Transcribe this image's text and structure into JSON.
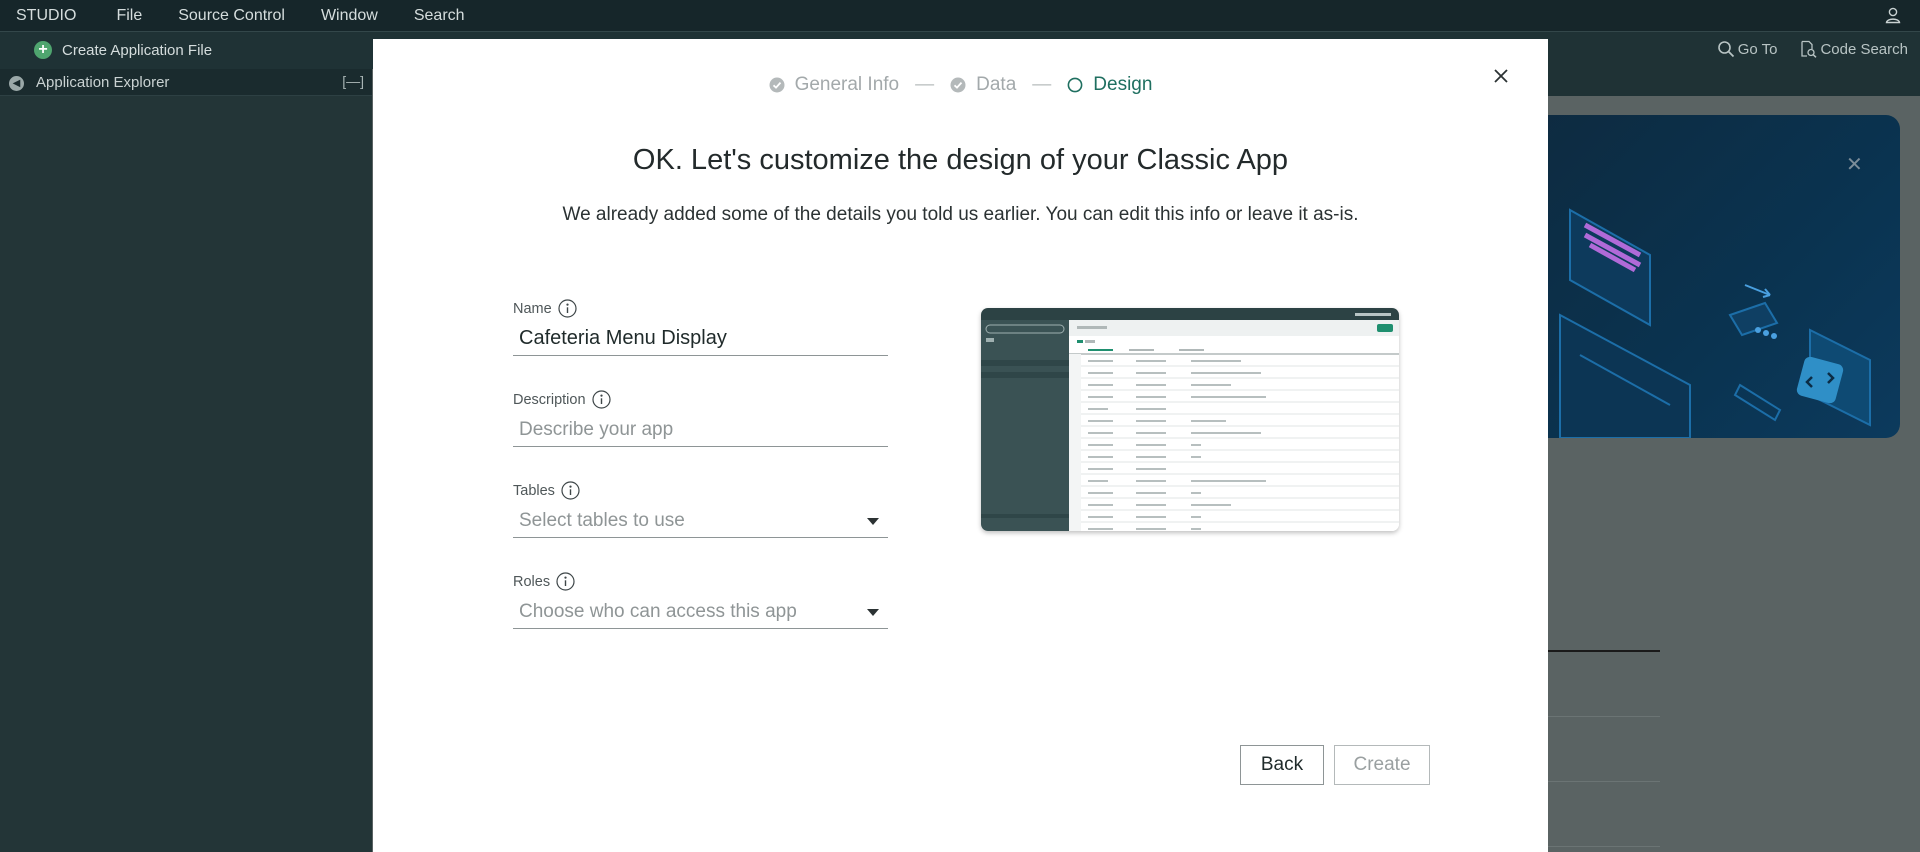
{
  "menubar": {
    "brand": "STUDIO",
    "items": [
      "File",
      "Source Control",
      "Window",
      "Search"
    ]
  },
  "toolbar": {
    "create_file_label": "Create Application File",
    "goto_label": "Go To",
    "code_search_label": "Code Search"
  },
  "explorer": {
    "title": "Application Explorer",
    "collapse_glyph": "[—]"
  },
  "modal": {
    "steps": [
      {
        "label": "General Info",
        "state": "done"
      },
      {
        "label": "Data",
        "state": "done"
      },
      {
        "label": "Design",
        "state": "active"
      }
    ],
    "step_separator": "—",
    "heading": "OK. Let's customize the design of your Classic App",
    "subheading": "We already added some of the details you told us earlier. You can edit this info or leave it as-is.",
    "fields": {
      "name": {
        "label": "Name",
        "value": "Cafeteria Menu Display"
      },
      "description": {
        "label": "Description",
        "placeholder": "Describe your app"
      },
      "tables": {
        "label": "Tables",
        "placeholder": "Select tables to use"
      },
      "roles": {
        "label": "Roles",
        "placeholder": "Choose who can access this app"
      }
    },
    "back_label": "Back",
    "create_label": "Create"
  },
  "colors": {
    "accent": "#1f6f60",
    "done_step": "#a3a9ab",
    "menubar_bg": "#16262a",
    "sidebar_bg": "#233537",
    "plus_green": "#4fa56f"
  },
  "icons": {
    "close": "close-icon",
    "info": "info-icon",
    "step_done": "check-circle-icon",
    "step_active": "circle-outline-icon",
    "dropdown": "caret-down-icon",
    "goto": "magnifier-icon",
    "code_search": "document-search-icon",
    "user": "user-icon",
    "add": "plus-circle-icon"
  }
}
